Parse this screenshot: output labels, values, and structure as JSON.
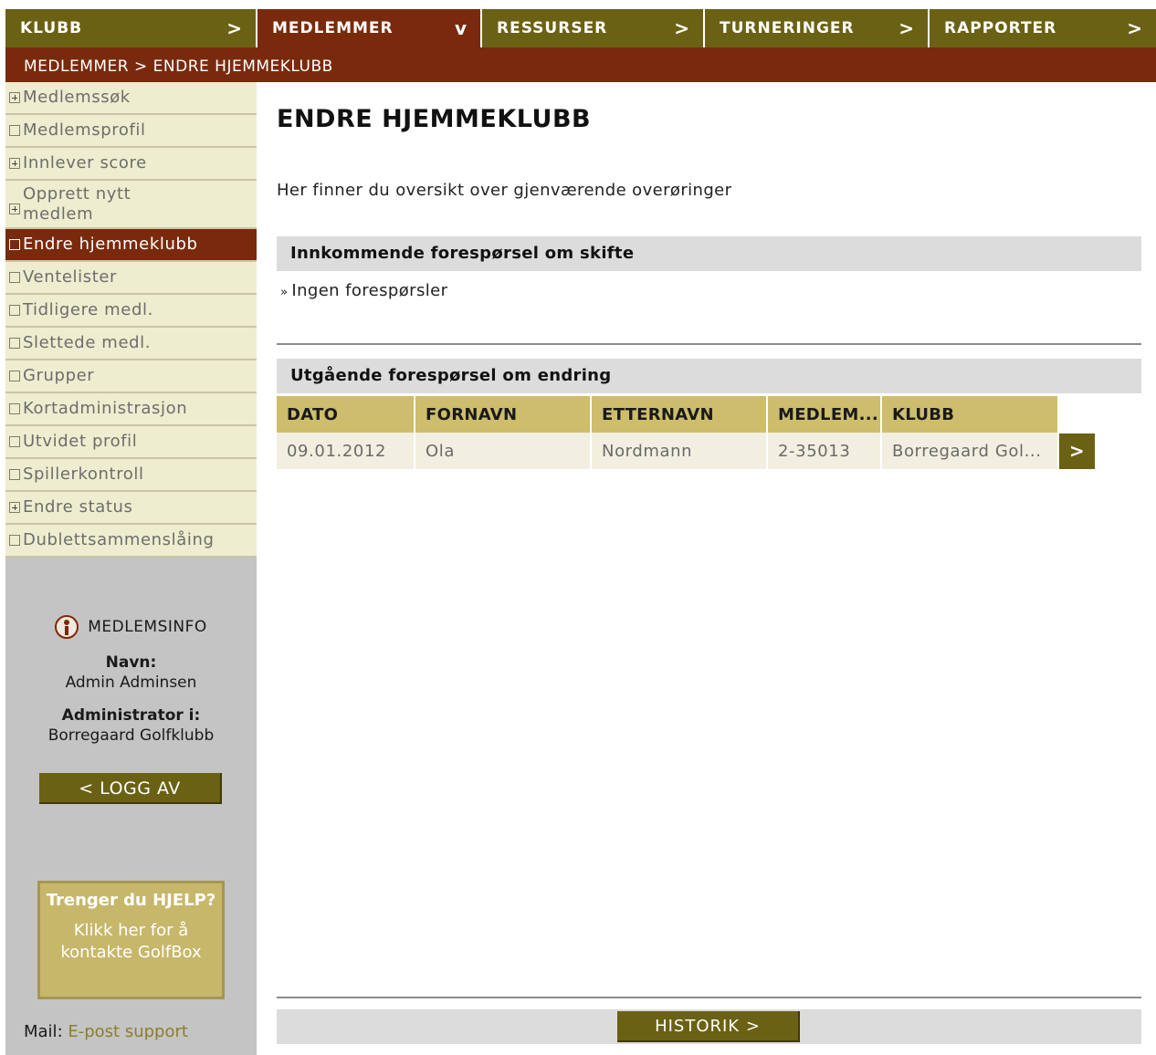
{
  "topnav": [
    {
      "label": "KLUBB",
      "icon": "chevron-right-icon",
      "glyph": ">"
    },
    {
      "label": "MEDLEMMER",
      "icon": "chevron-down-icon",
      "glyph": "v"
    },
    {
      "label": "RESSURSER",
      "icon": "chevron-right-icon",
      "glyph": ">"
    },
    {
      "label": "TURNERINGER",
      "icon": "chevron-right-icon",
      "glyph": ">"
    },
    {
      "label": "RAPPORTER",
      "icon": "chevron-right-icon",
      "glyph": ">"
    }
  ],
  "breadcrumb": "MEDLEMMER > ENDRE HJEMMEKLUBB",
  "sidebar": {
    "items": [
      {
        "label": "Medlemssøk",
        "icon": "plus-box-icon"
      },
      {
        "label": "Medlemsprofil",
        "icon": "box-icon"
      },
      {
        "label": "Innlever score",
        "icon": "plus-box-icon"
      },
      {
        "label": "Opprett nytt medlem",
        "icon": "plus-box-icon"
      },
      {
        "label": "Endre hjemmeklubb",
        "icon": "box-icon"
      },
      {
        "label": "Ventelister",
        "icon": "box-icon"
      },
      {
        "label": "Tidligere medl.",
        "icon": "box-icon"
      },
      {
        "label": "Slettede medl.",
        "icon": "box-icon"
      },
      {
        "label": "Grupper",
        "icon": "box-icon"
      },
      {
        "label": "Kortadministrasjon",
        "icon": "box-icon"
      },
      {
        "label": "Utvidet profil",
        "icon": "box-icon"
      },
      {
        "label": "Spillerkontroll",
        "icon": "box-icon"
      },
      {
        "label": "Endre status",
        "icon": "plus-box-icon"
      },
      {
        "label": "Dublettsammenslåing",
        "icon": "box-icon"
      }
    ],
    "active_item": "Endre hjemmeklubb",
    "memberinfo": {
      "heading": "MEDLEMSINFO",
      "name_label": "Navn:",
      "name_value": "Admin Adminsen",
      "admin_label": "Administrator i:",
      "admin_value": "Borregaard Golfklubb",
      "logout_label": "< LOGG AV"
    },
    "help": {
      "title": "Trenger du HJELP?",
      "text": "Klikk her for å kontakte GolfBox"
    },
    "mail": {
      "label": "Mail:",
      "link": "E-post support"
    }
  },
  "main": {
    "title": "ENDRE HJEMMEKLUBB",
    "intro": "Her finner du oversikt over gjenværende overøringer",
    "incoming": {
      "heading": "Innkommende forespørsel om skifte",
      "empty_text": "Ingen forespørsler"
    },
    "outgoing": {
      "heading": "Utgående forespørsel om endring",
      "columns": [
        "DATO",
        "FORNAVN",
        "ETTERNAVN",
        "MEDLEM...",
        "KLUBB"
      ],
      "rows": [
        {
          "dato": "09.01.2012",
          "fornavn": "Ola",
          "etternavn": "Nordmann",
          "medlem": "2-35013",
          "klubb": "Borregaard Gol..."
        }
      ]
    },
    "historik_label": "HISTORIK >"
  },
  "colors": {
    "nav_olive": "#6b6114",
    "accent_brown": "#7a2a0c",
    "table_header": "#cdbd6c",
    "sidebar_item_bg": "#eeedcf"
  }
}
